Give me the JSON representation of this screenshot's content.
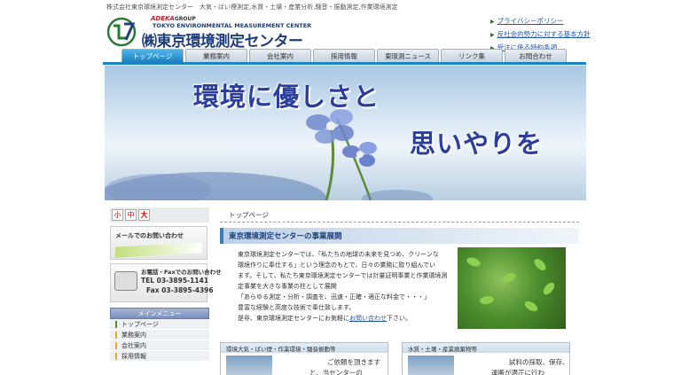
{
  "header": {
    "tagline": "株式会社東京環境測定センター　大気・ばい煙測定,水質・土壌・産業分析,騒音・振動測定,作業環境測定",
    "logo_group": "ADEKA",
    "logo_group_suffix": "GROUP",
    "logo_en": "TOKYO ENVIRONMENTAL MEASUREMENT CENTER",
    "logo_jp": "㈱東京環境測定センター",
    "links": [
      {
        "label": "プライバシーポリシー"
      },
      {
        "label": "反社会的勢力に対する基本方針"
      },
      {
        "label": "受注に係る特約条項"
      }
    ]
  },
  "nav": {
    "items": [
      {
        "label": "トップページ"
      },
      {
        "label": "業務案内"
      },
      {
        "label": "会社案内"
      },
      {
        "label": "採用情報"
      },
      {
        "label": "東環測ニュース"
      },
      {
        "label": "リンク集"
      },
      {
        "label": "お問合わせ"
      }
    ]
  },
  "hero": {
    "line1": "環境に優しさと",
    "line2": "思いやりを"
  },
  "sidebar": {
    "font_sizes": [
      "小",
      "中",
      "大"
    ],
    "mail_contact": "メールでのお問い合わせ",
    "tel_title": "お電話・Faxでのお問い合わせ",
    "tel": "TEL 03-3895-1141",
    "fax": "Fax 03-3895-4396",
    "menu_title": "メインメニュー",
    "menu_items": [
      {
        "label": "トップページ"
      },
      {
        "label": "業務案内"
      },
      {
        "label": "会社案内"
      },
      {
        "label": "採用情報"
      }
    ]
  },
  "main": {
    "breadcrumb": "トップページ",
    "section_title": "東京環境測定センターの事業展開",
    "paragraph_lines": [
      "東京環境測定センターでは、「私たちの地球の未来を見つめ、クリーンな",
      "環境作りに奉仕する」という理念のもとで、日々の業務に取り組んでい",
      "ます。そして、私たち東京環境測定センターでは計量証明事業と作業環境測",
      "定事業を大きな事業の柱として展開",
      "「あらゆる測定・分析・調査を、迅速・正確・適正な料金で・・・」",
      "豊富な経験と高度な技術で奉仕致します。"
    ],
    "closing_prefix": "是非、東京環境測定センターにお気軽に",
    "closing_link": "お問い合わせ",
    "closing_suffix": "下さい。",
    "cards": [
      {
        "title": "環境大気・ばい煙・作業環境・騒音振動等",
        "text1": "ご依頼を頂きます",
        "text2": "と、当センターの"
      },
      {
        "title": "水質・土壌・産業廃棄物等",
        "text1": "試料の採取、保存、",
        "text2": "運搬が適正に行わ"
      }
    ]
  },
  "colors": {
    "nav_active": "#1d82c4",
    "brand_blue": "#1e3d7a",
    "hero_text": "#2d3e9a",
    "link": "#2255aa"
  }
}
